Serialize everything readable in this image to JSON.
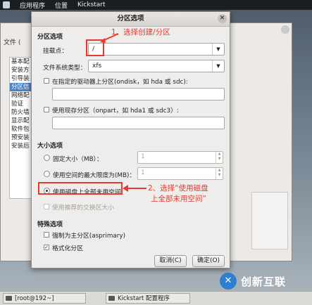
{
  "topbar": {
    "apps": "应用程序",
    "places": "位置",
    "app_name": "Kickstart"
  },
  "bg_window": {
    "menu_file": "文件 (",
    "side_items": [
      "基本配",
      "安装方",
      "引导装",
      "分区信",
      "网络配",
      "验证",
      "防火墙",
      "显示配",
      "软件包",
      "预安装",
      "安装后"
    ],
    "selected_index": 3
  },
  "dialog": {
    "title": "分区选项",
    "sections": {
      "partition": "分区选项",
      "size": "大小选项",
      "special": "特殊选项"
    },
    "mount_point": {
      "label": "挂载点：",
      "value": "/"
    },
    "fs_type": {
      "label": "文件系统类型：",
      "value": "xfs"
    },
    "drive_checkbox": "在指定的驱动器上分区(ondisk，如 hda 或 sdc):",
    "existing_checkbox": "使用现存分区（onpart，如 hda1 或 sdc3）:",
    "size_options": {
      "fixed": "固定大小（MB）：",
      "fixed_value": "1",
      "max": "使用空间的最大限度为(MB)：",
      "max_value": "1",
      "fill": "使用磁盘上全部未用空间",
      "swap": "使用推荐的交换区大小"
    },
    "primary_checkbox": "强制为主分区(asprimary)",
    "format_checkbox": "格式化分区",
    "cancel_button": "取消(C)",
    "ok_button": "确定(O)"
  },
  "annotations": {
    "step1": "1、选择创建/分区",
    "step2_line1": "2、选择“使用磁盘",
    "step2_line2": "上全部未用空间”"
  },
  "taskbar": {
    "terminal": "[root@192~]",
    "kickstart": "Kickstart 配置程序"
  },
  "logo": {
    "text": "创新互联"
  },
  "colors": {
    "annotation_red": "#e53a2f",
    "selection_blue": "#4a84c9"
  }
}
